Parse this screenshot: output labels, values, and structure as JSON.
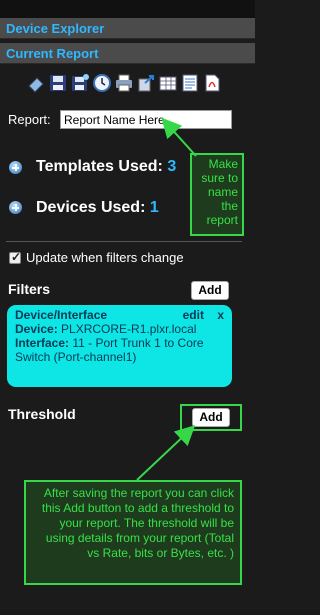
{
  "panels": {
    "device_explorer": "Device Explorer",
    "current_report": "Current Report"
  },
  "toolbar": {
    "icons": [
      "eraser-icon",
      "save-icon",
      "save-as-icon",
      "schedule-clock-icon",
      "print-icon",
      "export-icon",
      "table-icon",
      "csv-icon",
      "pdf-icon"
    ]
  },
  "report": {
    "label": "Report:",
    "name_value": "Report Name Here"
  },
  "templates": {
    "label": "Templates Used:",
    "count": "3"
  },
  "devices": {
    "label": "Devices Used:",
    "count": "1"
  },
  "callouts": {
    "name_note": "Make sure to name the report",
    "threshold_note": "After saving the report you can click this Add button to add a threshold to your report.  The threshold will be using details from your report (Total vs Rate, bits or Bytes, etc. )"
  },
  "update_filters": {
    "label": "Update when filters change",
    "checked": true
  },
  "filters": {
    "title": "Filters",
    "add_label": "Add",
    "card": {
      "header": "Device/Interface",
      "edit": "edit",
      "remove": "x",
      "device_key": "Device:",
      "device_value": "PLXRCORE-R1.plxr.local",
      "interface_key": "Interface:",
      "interface_value": "11 - Port Trunk 1 to Core Switch (Port-channel1)"
    }
  },
  "threshold": {
    "title": "Threshold",
    "add_label": "Add"
  },
  "colors": {
    "accent_blue": "#2fb8ff",
    "callout_green": "#36d84a",
    "filter_card": "#0ee6e6"
  }
}
